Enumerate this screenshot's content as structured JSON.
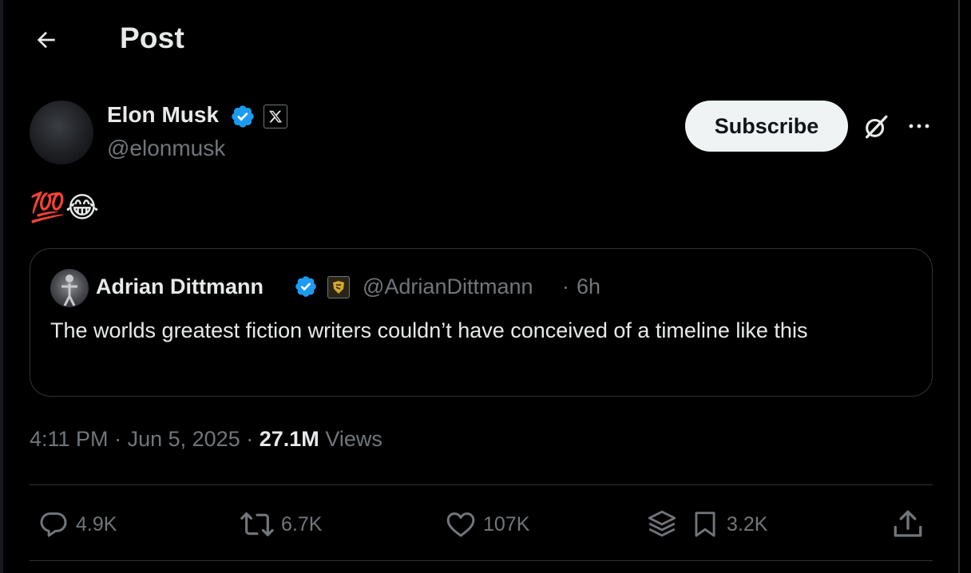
{
  "header": {
    "title": "Post"
  },
  "author": {
    "name": "Elon Musk",
    "handle": "@elonmusk"
  },
  "actions_top": {
    "subscribe_label": "Subscribe"
  },
  "post": {
    "text": "💯😂"
  },
  "quote": {
    "name": "Adrian Dittmann",
    "handle": "@AdrianDittmann",
    "separator": "·",
    "time": "6h",
    "text": "The worlds greatest fiction writers couldn’t have conceived of a timeline like this"
  },
  "meta": {
    "time": "4:11 PM",
    "date": "Jun 5, 2025",
    "views_count": "27.1M",
    "views_label": "Views",
    "separator": "·"
  },
  "engagement": {
    "replies": "4.9K",
    "reposts": "6.7K",
    "likes": "107K",
    "bookmarks": "3.2K"
  },
  "colors": {
    "background": "#000000",
    "text": "#e7e9ea",
    "muted": "#71767b",
    "verified": "#1d9bf0",
    "border": "#2f3336",
    "button": "#eff3f4"
  }
}
